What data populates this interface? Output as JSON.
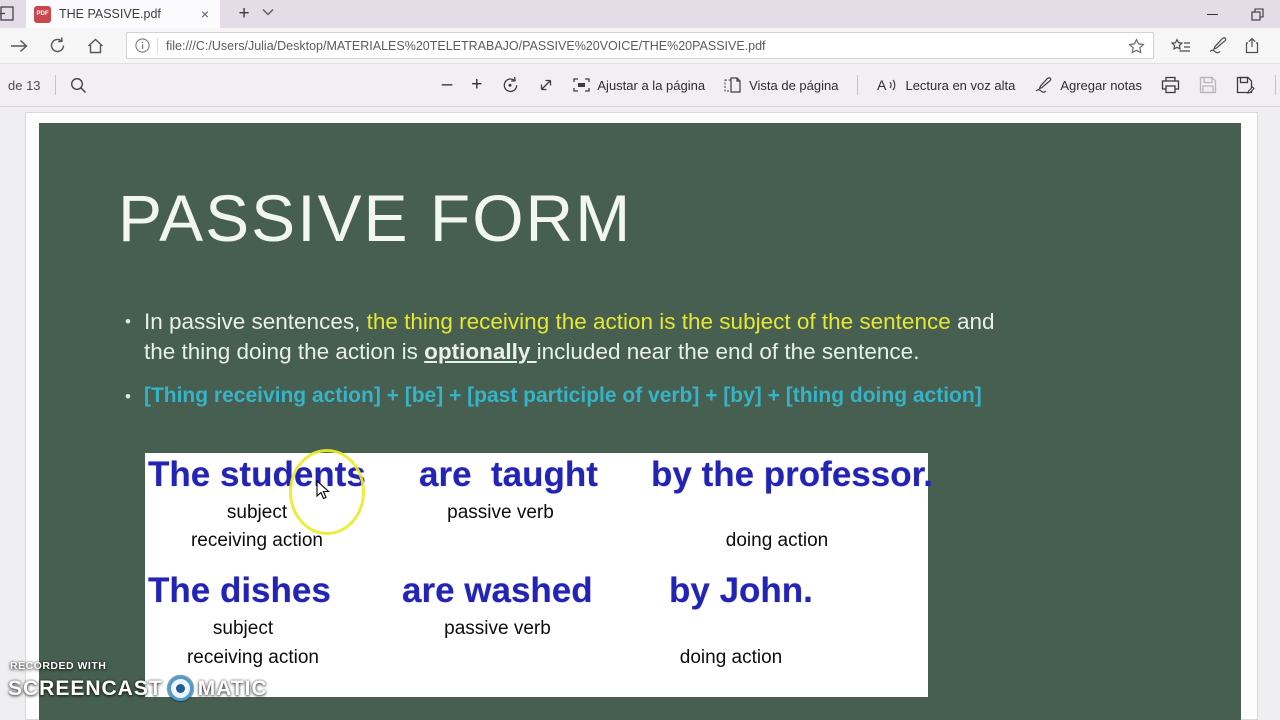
{
  "tabbar": {
    "tab_title": "THE PASSIVE.pdf",
    "pdf_icon_text": "PDF"
  },
  "icons": {
    "new_tab": "+",
    "close_tab": "×"
  },
  "navbar": {
    "url": "file:///C:/Users/Julia/Desktop/MATERIALES%20TELETRABAJO/PASSIVE%20VOICE/THE%20PASSIVE.pdf"
  },
  "pdf_toolbar": {
    "page_indicator": "de 13",
    "zoom_out": "—",
    "zoom_in": "+",
    "fit_page": "Ajustar a la página",
    "page_view": "Vista de página",
    "read_aloud": "Lectura en voz alta",
    "add_notes": "Agregar notas"
  },
  "slide": {
    "title": "PASSIVE FORM",
    "bullet1": {
      "p1": "In passive sentences, ",
      "p2": "the thing receiving the action is the subject of the sentence",
      "p3": " and",
      "p4": "the thing doing the action is ",
      "p5": "optionally ",
      "p6": "included near the end of the sentence."
    },
    "bullet2": "[Thing receiving action] + [be] + [past participle of verb] + [by] + [thing doing action]",
    "examples": [
      {
        "subject": "The students",
        "verb": "are  taught",
        "agent": "by the professor.",
        "label_subject": "subject",
        "label_verb": "passive verb",
        "label_receiving": "receiving action",
        "label_doing": "doing action"
      },
      {
        "subject": "The dishes",
        "verb": "are washed",
        "agent": "by John.",
        "label_subject": "subject",
        "label_verb": "passive verb",
        "label_receiving": "receiving action",
        "label_doing": "doing action"
      }
    ]
  },
  "watermark": {
    "line1": "RECORDED WITH",
    "brand1": "SCREENCAST",
    "brand2": "MATIC"
  },
  "colors": {
    "slide_bg": "#475f50",
    "accent_yellow": "#e5e733",
    "accent_cyan": "#36b3c7",
    "example_blue": "#2424b4"
  }
}
